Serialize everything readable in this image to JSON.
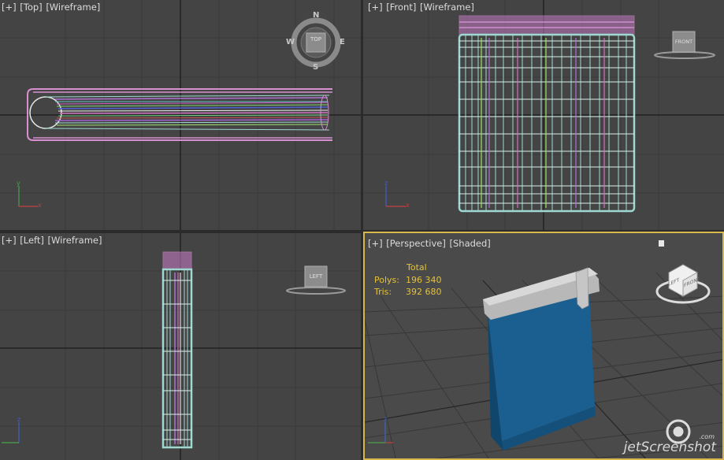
{
  "viewports": {
    "top": {
      "plus": "[+]",
      "view": "[Top]",
      "mode": "[Wireframe]",
      "cube_label": "TOP",
      "compass": {
        "n": "N",
        "s": "S",
        "e": "E",
        "w": "W"
      }
    },
    "front": {
      "plus": "[+]",
      "view": "[Front]",
      "mode": "[Wireframe]",
      "cube_label": "FRONT"
    },
    "left": {
      "plus": "[+]",
      "view": "[Left]",
      "mode": "[Wireframe]",
      "cube_label": "LEFT"
    },
    "perspective": {
      "plus": "[+]",
      "view": "[Perspective]",
      "mode": "[Shaded]",
      "cube_left": "LEFT",
      "cube_front": "FRONT"
    }
  },
  "stats": {
    "header": "Total",
    "polys_label": "Polys:",
    "polys_value": "196 340",
    "tris_label": "Tris:",
    "tris_value": "392 680"
  },
  "axes": {
    "x": "x",
    "y": "y",
    "z": "z"
  },
  "watermark": {
    "text": "jetScreenshot",
    "com": ".com"
  },
  "colors": {
    "viewport_bg": "#444444",
    "active_border": "#d8b84a",
    "stats_text": "#e6c23a",
    "wire_pink": "#d890d0",
    "wire_cyan": "#9ed8d0",
    "book_blue": "#1a5f90"
  }
}
